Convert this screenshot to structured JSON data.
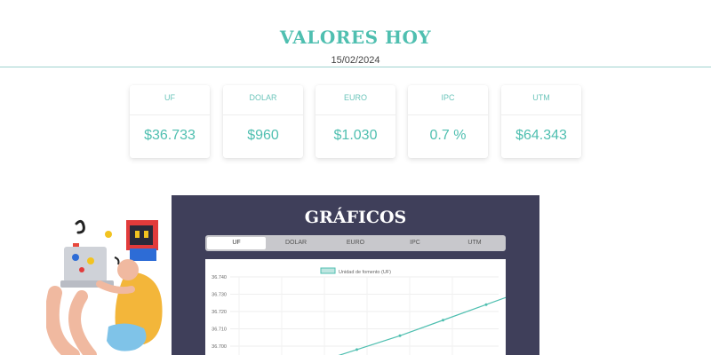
{
  "header": {
    "title": "VALORES HOY",
    "date": "15/02/2024"
  },
  "cards": [
    {
      "label": "UF",
      "value": "$36.733"
    },
    {
      "label": "DOLAR",
      "value": "$960"
    },
    {
      "label": "EURO",
      "value": "$1.030"
    },
    {
      "label": "IPC",
      "value": "0.7 %"
    },
    {
      "label": "UTM",
      "value": "$64.343"
    }
  ],
  "charts": {
    "heading": "GRÁFICOS",
    "tabs": [
      "UF",
      "DOLAR",
      "EURO",
      "IPC",
      "UTM"
    ],
    "active_tab": "UF"
  },
  "colors": {
    "accent": "#4fbfb0",
    "panel": "#3f3f5a"
  },
  "chart_data": {
    "type": "line",
    "title": "",
    "legend": "Unidad de fomento (UF)",
    "legend_placement": "top",
    "grid": true,
    "y_ticks": [
      "36.740",
      "36.730",
      "36.720",
      "36.710",
      "36.700"
    ],
    "ylim": [
      36.69,
      36.74
    ],
    "series": [
      {
        "name": "Unidad de fomento (UF)",
        "values": [
          36.69,
          36.698,
          36.706,
          36.715,
          36.724,
          36.733
        ]
      }
    ]
  }
}
